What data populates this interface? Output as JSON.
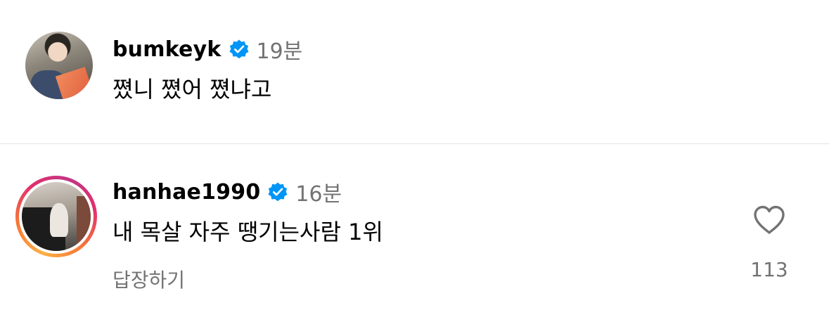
{
  "comments": [
    {
      "username": "bumkeyk",
      "verified": true,
      "time": "19분",
      "text": "쪘니 쪘어 쪘냐고",
      "avatar_icon": "profile-photo-avatar",
      "has_story_ring": false
    },
    {
      "username": "hanhae1990",
      "verified": true,
      "time": "16분",
      "text": "내 목살 자주 땡기는사람 1위",
      "reply_label": "답장하기",
      "like_icon": "heart-outline-icon",
      "like_count": "113",
      "avatar_icon": "profile-photo-avatar",
      "has_story_ring": true
    }
  ],
  "colors": {
    "verified_blue": "#0095f6",
    "secondary_text": "#737373",
    "divider": "#e3e3e3"
  }
}
